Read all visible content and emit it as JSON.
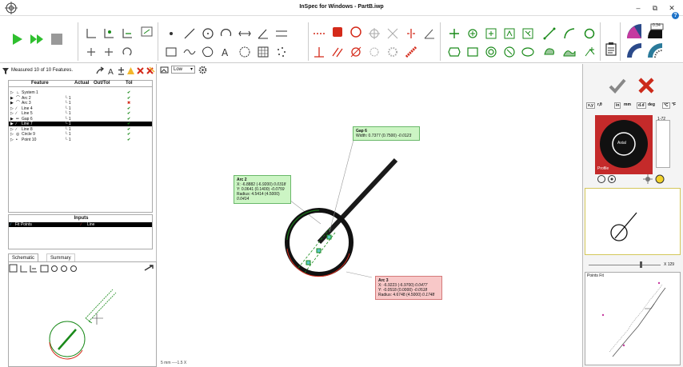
{
  "window": {
    "title": "InSpec for Windows - PartB.iwp",
    "minimize": "–",
    "restore": "⧉",
    "close": "✕",
    "help": "?"
  },
  "icons": {
    "app": "target-icon"
  },
  "status": {
    "text": "Measured 10 of 10 Features.",
    "icon": "funnel-icon"
  },
  "table": {
    "headers": {
      "feature": "Feature",
      "actual": "Actual",
      "outtol": "Out/Tol",
      "tol": "Tol"
    },
    "rows": [
      {
        "name": "System 1",
        "ref": "",
        "tol": "✔",
        "tol_color": "#1a8a1a",
        "expander": "▷",
        "icon": "∟"
      },
      {
        "name": "Arc 2",
        "ref": "└ 1",
        "tol": "✔",
        "tol_color": "#1a8a1a",
        "expander": "▶",
        "icon": "⌒"
      },
      {
        "name": "Arc 3",
        "ref": "└ 1",
        "tol": "✖",
        "tol_color": "#d42a1a",
        "expander": "▶",
        "icon": "⌒"
      },
      {
        "name": "Line 4",
        "ref": "└ 1",
        "tol": "✔",
        "tol_color": "#1a8a1a",
        "expander": "▷",
        "icon": "∕"
      },
      {
        "name": "Line 5",
        "ref": "└ 1",
        "tol": "✔",
        "tol_color": "#1a8a1a",
        "expander": "▷",
        "icon": "∕"
      },
      {
        "name": "Gap 6",
        "ref": "└ 1",
        "tol": "✔",
        "tol_color": "#1a8a1a",
        "expander": "▶",
        "icon": "═"
      },
      {
        "name": "Line 7",
        "ref": "└ 1",
        "tol": "✔",
        "tol_color": "#1a8a1a",
        "expander": "▶",
        "icon": "∕",
        "selected": true
      },
      {
        "name": "Line 8",
        "ref": "└ 1",
        "tol": "✔",
        "tol_color": "#1a8a1a",
        "expander": "▷",
        "icon": "∕"
      },
      {
        "name": "Circle 9",
        "ref": "└ 1",
        "tol": "✔",
        "tol_color": "#1a8a1a",
        "expander": "▷",
        "icon": "◎"
      },
      {
        "name": "Point 10",
        "ref": "└ 1",
        "tol": "✔",
        "tol_color": "#1a8a1a",
        "expander": "▷",
        "icon": "•"
      }
    ]
  },
  "inputs": {
    "title": "Inputs",
    "fit_label": "Fit Points",
    "line_label": "Line"
  },
  "tabs": {
    "schematic": "Schematic",
    "summary": "Summary"
  },
  "canvas": {
    "dropdown": "Low",
    "scale": "5 mm ----1.5 X"
  },
  "callouts": {
    "gap": {
      "title": "Gap 6",
      "line1": "Width: 0.7377 (0.7500)",
      "dev1": "-0.0123"
    },
    "arc2": {
      "title": "Arc 2",
      "x": "X: -6.8882 (-6.9200)",
      "xd": "0.0318",
      "y": "Y: 0.0641 (0.1400)",
      "yd": "-0.0759",
      "r": "Radius: 4.5414 (4.5000)",
      "rd": "0.0414"
    },
    "arc3": {
      "title": "Arc 3",
      "x": "X: -6.9223 (-6.9700)",
      "xd": "0.0477",
      "y": "Y: -0.0518 (0.0000)",
      "yd": "-0.0518",
      "r": "Radius: 4.6748 (4.5000)",
      "rd": "0.1748"
    }
  },
  "right": {
    "axial": "Axial",
    "profile": "Profile",
    "range": "1-72",
    "zoom": "X 129",
    "points_fit": "Points Fit",
    "units": [
      "x,y",
      "r,θ",
      "in",
      "mm",
      "d.d",
      "deg",
      "°C",
      "°F"
    ],
    "calc_label": "0.34"
  },
  "colors": {
    "accept": "#888888",
    "reject": "#cc2a1a",
    "green": "#1a8a1a",
    "red": "#d42a1a",
    "callout_green": "#ccf5c4",
    "callout_red": "#f8c8c8"
  }
}
